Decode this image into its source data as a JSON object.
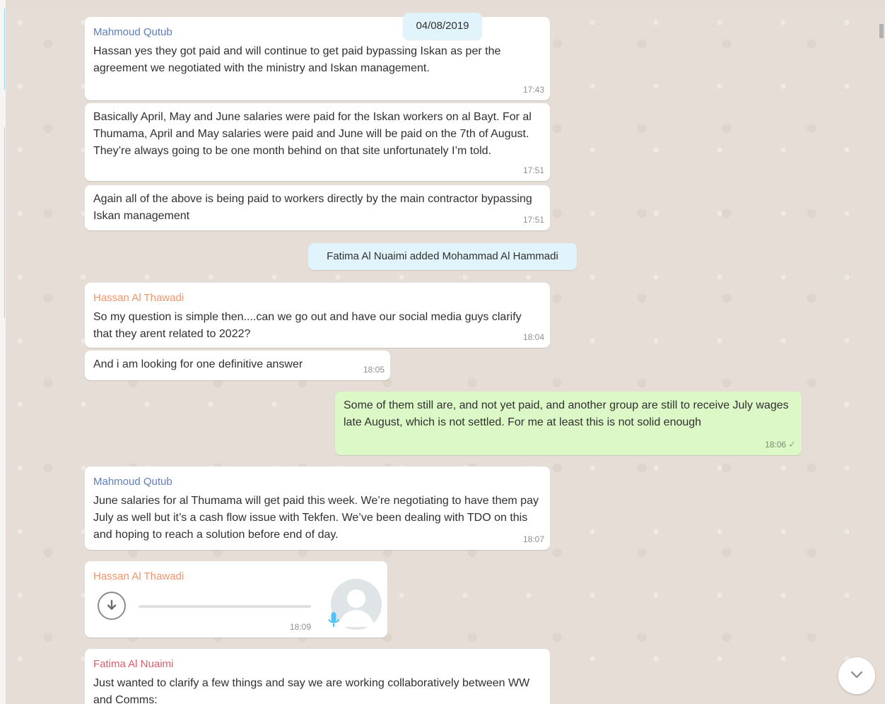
{
  "date_badge": "04/08/2019",
  "colors": {
    "name_mahmoud": "#5f7db8",
    "name_hassan": "#f3936a",
    "name_fatima": "#e35c6b"
  },
  "icons": {
    "download": "download-icon",
    "avatar": "default-avatar-icon",
    "mic": "microphone-icon",
    "scroll": "chevron-down-icon",
    "tick": "single-check-icon"
  },
  "messages": [
    {
      "sender": "Mahmoud Qutub",
      "text": "Hassan yes they got paid and will continue to get paid bypassing Iskan as per the agreement we negotiated with the ministry and Iskan management.",
      "time": "17:43"
    },
    {
      "text": "Basically April, May and June salaries were paid for the Iskan workers on al Bayt. For al Thumama, April and May salaries were paid and June will be paid on the 7th of August. They’re always going to be one month behind on that site unfortunately I’m told.",
      "time": "17:51"
    },
    {
      "text": "Again all of the above is being paid to workers directly by the main contractor bypassing Iskan management",
      "time": "17:51"
    },
    {
      "system": "Fatima Al Nuaimi added Mohammad Al Hammadi"
    },
    {
      "sender": "Hassan Al Thawadi",
      "text": "So my question is simple then....can we go out and have our social media guys clarify that they arent related to 2022?",
      "time": "18:04"
    },
    {
      "text": "And i am looking for one definitive answer",
      "time": "18:05"
    },
    {
      "text": "Some of them still are, and not yet paid, and another group are still to receive July wages late August, which is not settled. For me at least this is not solid enough",
      "time": "18:06",
      "tick": "✓"
    },
    {
      "sender": "Mahmoud Qutub",
      "text": "June salaries for al Thumama will get paid this week. We’re negotiating to have them pay July as well but it’s a cash flow issue with Tekfen. We’ve been dealing with TDO on this and hoping to reach a solution before end of day.",
      "time": "18:07"
    },
    {
      "sender": "Hassan Al Thawadi",
      "time": "18:09"
    },
    {
      "sender": "Fatima Al Nuaimi",
      "text": "Just wanted to clarify a few things and say we are working collaboratively between WW and Comms:"
    }
  ]
}
